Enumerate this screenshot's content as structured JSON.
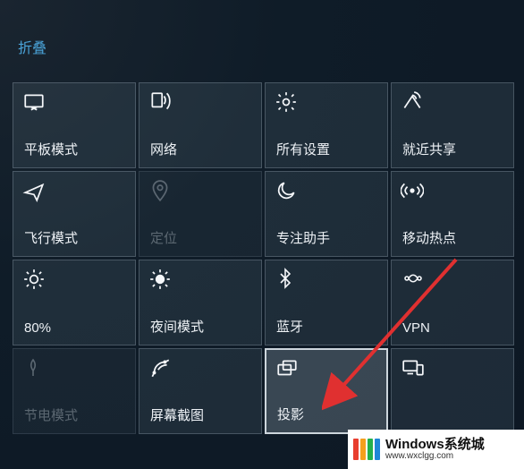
{
  "collapse_label": "折叠",
  "tiles": [
    {
      "id": "tablet-mode",
      "label": "平板模式",
      "disabled": false,
      "highlight": false
    },
    {
      "id": "network",
      "label": "网络",
      "disabled": false,
      "highlight": false
    },
    {
      "id": "all-settings",
      "label": "所有设置",
      "disabled": false,
      "highlight": false
    },
    {
      "id": "near-share",
      "label": "就近共享",
      "disabled": false,
      "highlight": false
    },
    {
      "id": "airplane-mode",
      "label": "飞行模式",
      "disabled": false,
      "highlight": false
    },
    {
      "id": "location",
      "label": "定位",
      "disabled": true,
      "highlight": false
    },
    {
      "id": "focus-assist",
      "label": "专注助手",
      "disabled": false,
      "highlight": false
    },
    {
      "id": "hotspot",
      "label": "移动热点",
      "disabled": false,
      "highlight": false
    },
    {
      "id": "brightness",
      "label": "80%",
      "disabled": false,
      "highlight": false
    },
    {
      "id": "night-light",
      "label": "夜间模式",
      "disabled": false,
      "highlight": false
    },
    {
      "id": "bluetooth",
      "label": "蓝牙",
      "disabled": false,
      "highlight": false
    },
    {
      "id": "vpn",
      "label": "VPN",
      "disabled": false,
      "highlight": false
    },
    {
      "id": "battery-saver",
      "label": "节电模式",
      "disabled": true,
      "highlight": false
    },
    {
      "id": "screenshot",
      "label": "屏幕截图",
      "disabled": false,
      "highlight": false
    },
    {
      "id": "project",
      "label": "投影",
      "disabled": false,
      "highlight": true
    },
    {
      "id": "connect",
      "label": "",
      "disabled": false,
      "highlight": false
    }
  ],
  "watermark": {
    "title": "Windows系统城",
    "sub": "www.wxclgg.com",
    "bars": [
      "#e83e2f",
      "#f5a01d",
      "#24b04b",
      "#1f87d6"
    ]
  }
}
